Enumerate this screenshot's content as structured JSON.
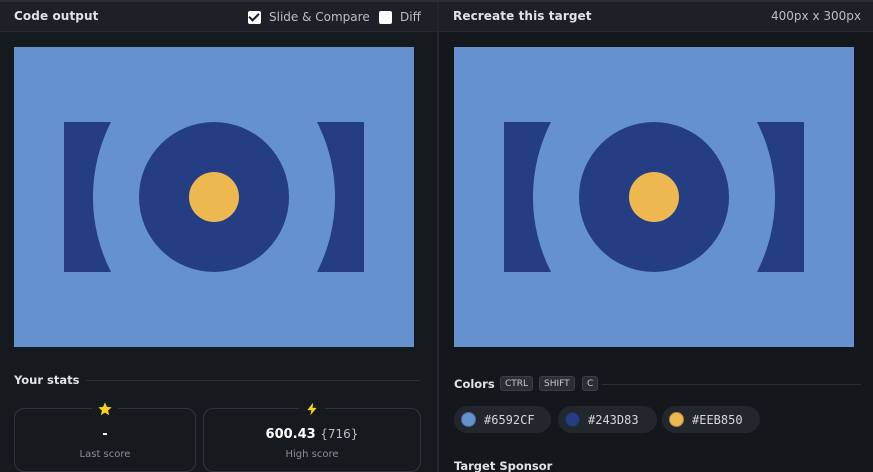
{
  "left_panel": {
    "title": "Code output",
    "slide_compare": {
      "label": "Slide & Compare",
      "checked": true
    },
    "diff": {
      "label": "Diff",
      "checked": false
    }
  },
  "right_panel": {
    "title": "Recreate this target",
    "dimensions": "400px x 300px"
  },
  "stats": {
    "title": "Your stats",
    "last_score": {
      "value": "-",
      "label": "Last score",
      "icon": "star-icon"
    },
    "high_score": {
      "value": "600.43",
      "detail": "{716}",
      "label": "High score",
      "icon": "lightning-icon"
    }
  },
  "colors": {
    "title": "Colors",
    "shortcut_keys": [
      "CTRL",
      "SHIFT",
      "C"
    ],
    "swatches": [
      {
        "hex": "#6592CF"
      },
      {
        "hex": "#243D83"
      },
      {
        "hex": "#EEB850"
      }
    ]
  },
  "sponsor": {
    "title": "Target Sponsor"
  },
  "palette": {
    "background": "#6592CF",
    "primary": "#243D83",
    "accent": "#EEB850"
  }
}
